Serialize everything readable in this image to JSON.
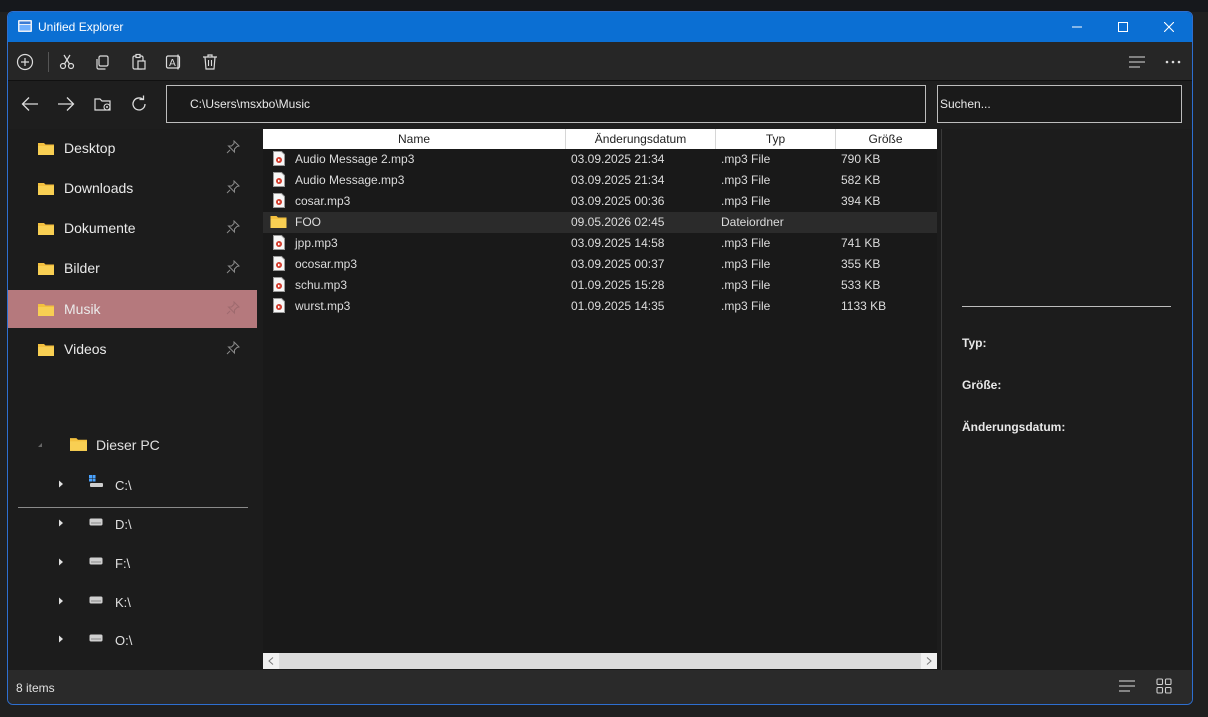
{
  "window": {
    "title": "Unified Explorer",
    "accent": "#0b6fd3"
  },
  "toolbar": {
    "icons": [
      "add-icon",
      "cut-icon",
      "copy-icon",
      "paste-icon",
      "rename-icon",
      "delete-icon",
      "view-list-icon",
      "more-icon"
    ]
  },
  "nav": {
    "address_value": "C:\\Users\\msxbo\\Music",
    "search_placeholder": "Suchen..."
  },
  "sidebar": {
    "favorites": [
      {
        "label": "Desktop"
      },
      {
        "label": "Downloads"
      },
      {
        "label": "Dokumente"
      },
      {
        "label": "Bilder"
      },
      {
        "label": "Musik",
        "selected": true
      },
      {
        "label": "Videos"
      }
    ],
    "tree": {
      "root": "Dieser PC",
      "drives": [
        "C:\\",
        "D:\\",
        "F:\\",
        "K:\\",
        "O:\\"
      ]
    }
  },
  "files": {
    "columns": [
      "Name",
      "Änderungsdatum",
      "Typ",
      "Größe"
    ],
    "rows": [
      {
        "name": "Audio Message 2.mp3",
        "date": "03.09.2025 21:34",
        "type": ".mp3 File",
        "size": "790 KB",
        "icon": "audio-file-icon"
      },
      {
        "name": "Audio Message.mp3",
        "date": "03.09.2025 21:34",
        "type": ".mp3 File",
        "size": "582 KB",
        "icon": "audio-file-icon"
      },
      {
        "name": "cosar.mp3",
        "date": "03.09.2025 00:36",
        "type": ".mp3 File",
        "size": "394 KB",
        "icon": "audio-file-icon"
      },
      {
        "name": "FOO",
        "date": "09.05.2026 02:45",
        "type": "Dateiordner",
        "size": "",
        "icon": "folder-icon"
      },
      {
        "name": "jpp.mp3",
        "date": "03.09.2025 14:58",
        "type": ".mp3 File",
        "size": "741 KB",
        "icon": "audio-file-icon"
      },
      {
        "name": "ocosar.mp3",
        "date": "03.09.2025 00:37",
        "type": ".mp3 File",
        "size": "355 KB",
        "icon": "audio-file-icon"
      },
      {
        "name": "schu.mp3",
        "date": "01.09.2025 15:28",
        "type": ".mp3 File",
        "size": "533 KB",
        "icon": "audio-file-icon"
      },
      {
        "name": "wurst.mp3",
        "date": "01.09.2025 14:35",
        "type": ".mp3 File",
        "size": "1133 KB",
        "icon": "audio-file-icon"
      }
    ]
  },
  "details": {
    "type_label": "Typ:",
    "size_label": "Größe:",
    "date_label": "Änderungsdatum:"
  },
  "status": {
    "count_text": "8 items"
  }
}
